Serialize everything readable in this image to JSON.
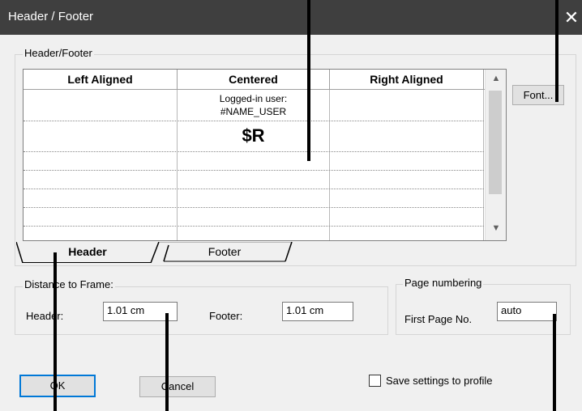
{
  "window": {
    "title": "Header / Footer",
    "close_glyph": "✕"
  },
  "group_header_footer": {
    "label": "Header/Footer"
  },
  "grid": {
    "columns": [
      "Left Aligned",
      "Centered",
      "Right Aligned"
    ],
    "cell_user_line1": "Logged-in user:",
    "cell_user_line2": "#NAME_USER",
    "cell_report": "$R"
  },
  "scrollbar": {
    "up_arrow": "▲",
    "down_arrow": "▼"
  },
  "tabs": {
    "header": "Header",
    "footer": "Footer"
  },
  "font_button": {
    "label": "Font..."
  },
  "distance": {
    "label": "Distance to Frame:",
    "header_label": "Header:",
    "header_value": "1.01 cm",
    "footer_label": "Footer:",
    "footer_value": "1.01 cm"
  },
  "page_numbering": {
    "label": "Page numbering",
    "first_page_label": "First Page No.",
    "first_page_value": "auto"
  },
  "buttons": {
    "ok": "OK",
    "cancel": "Cancel"
  },
  "save_profile": {
    "label": "Save settings to profile",
    "checked": false
  }
}
